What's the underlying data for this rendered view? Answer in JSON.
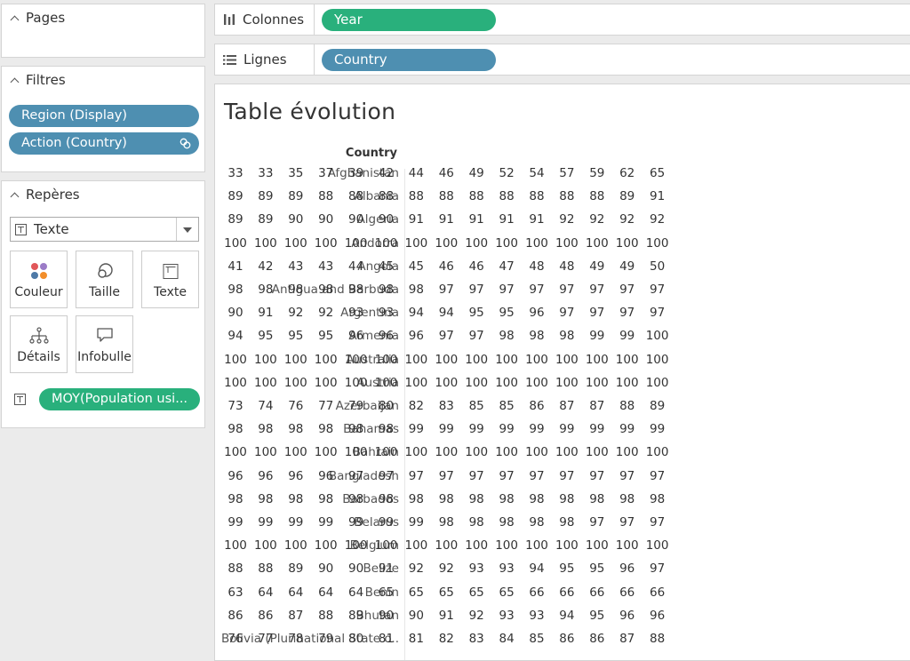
{
  "pages_panel": {
    "title": "Pages"
  },
  "filters_panel": {
    "title": "Filtres",
    "filters": [
      "Region (Display)",
      "Action (Country)"
    ]
  },
  "marks_panel": {
    "title": "Repères",
    "mark_type": "Texte",
    "buttons": [
      "Couleur",
      "Taille",
      "Texte",
      "Détails",
      "Infobulle"
    ],
    "text_field": "MOY(Population usi..."
  },
  "columns_shelf": {
    "label": "Colonnes",
    "pill": "Year"
  },
  "rows_shelf": {
    "label": "Lignes",
    "pill": "Country"
  },
  "view": {
    "title": "Table évolution",
    "row_header": "Country",
    "rows": [
      {
        "country": "Afghanistan",
        "values": [
          33,
          33,
          35,
          37,
          39,
          42,
          44,
          46,
          49,
          52,
          54,
          57,
          59,
          62,
          65
        ]
      },
      {
        "country": "Albania",
        "values": [
          89,
          89,
          89,
          88,
          88,
          88,
          88,
          88,
          88,
          88,
          88,
          88,
          88,
          89,
          91
        ]
      },
      {
        "country": "Algeria",
        "values": [
          89,
          89,
          90,
          90,
          90,
          90,
          91,
          91,
          91,
          91,
          91,
          92,
          92,
          92,
          92
        ]
      },
      {
        "country": "Andorra",
        "values": [
          100,
          100,
          100,
          100,
          100,
          100,
          100,
          100,
          100,
          100,
          100,
          100,
          100,
          100,
          100
        ]
      },
      {
        "country": "Angola",
        "values": [
          41,
          42,
          43,
          43,
          44,
          45,
          45,
          46,
          46,
          47,
          48,
          48,
          49,
          49,
          50
        ]
      },
      {
        "country": "Antigua and Barbuda",
        "values": [
          98,
          98,
          98,
          98,
          98,
          98,
          98,
          97,
          97,
          97,
          97,
          97,
          97,
          97,
          97
        ]
      },
      {
        "country": "Argentina",
        "values": [
          90,
          91,
          92,
          92,
          93,
          93,
          94,
          94,
          95,
          95,
          96,
          97,
          97,
          97,
          97
        ]
      },
      {
        "country": "Armenia",
        "values": [
          94,
          95,
          95,
          95,
          96,
          96,
          96,
          97,
          97,
          98,
          98,
          98,
          99,
          99,
          100
        ]
      },
      {
        "country": "Australia",
        "values": [
          100,
          100,
          100,
          100,
          100,
          100,
          100,
          100,
          100,
          100,
          100,
          100,
          100,
          100,
          100
        ]
      },
      {
        "country": "Austria",
        "values": [
          100,
          100,
          100,
          100,
          100,
          100,
          100,
          100,
          100,
          100,
          100,
          100,
          100,
          100,
          100
        ]
      },
      {
        "country": "Azerbaijan",
        "values": [
          73,
          74,
          76,
          77,
          79,
          80,
          82,
          83,
          85,
          85,
          86,
          87,
          87,
          88,
          89
        ]
      },
      {
        "country": "Bahamas",
        "values": [
          98,
          98,
          98,
          98,
          98,
          98,
          99,
          99,
          99,
          99,
          99,
          99,
          99,
          99,
          99
        ]
      },
      {
        "country": "Bahrain",
        "values": [
          100,
          100,
          100,
          100,
          100,
          100,
          100,
          100,
          100,
          100,
          100,
          100,
          100,
          100,
          100
        ]
      },
      {
        "country": "Bangladesh",
        "values": [
          96,
          96,
          96,
          96,
          97,
          97,
          97,
          97,
          97,
          97,
          97,
          97,
          97,
          97,
          97
        ]
      },
      {
        "country": "Barbados",
        "values": [
          98,
          98,
          98,
          98,
          98,
          98,
          98,
          98,
          98,
          98,
          98,
          98,
          98,
          98,
          98
        ]
      },
      {
        "country": "Belarus",
        "values": [
          99,
          99,
          99,
          99,
          99,
          99,
          99,
          98,
          98,
          98,
          98,
          98,
          97,
          97,
          97
        ]
      },
      {
        "country": "Belgium",
        "values": [
          100,
          100,
          100,
          100,
          100,
          100,
          100,
          100,
          100,
          100,
          100,
          100,
          100,
          100,
          100
        ]
      },
      {
        "country": "Belize",
        "values": [
          88,
          88,
          89,
          90,
          90,
          91,
          92,
          92,
          93,
          93,
          94,
          95,
          95,
          96,
          97
        ]
      },
      {
        "country": "Benin",
        "values": [
          63,
          64,
          64,
          64,
          64,
          65,
          65,
          65,
          65,
          65,
          66,
          66,
          66,
          66,
          66
        ]
      },
      {
        "country": "Bhutan",
        "values": [
          86,
          86,
          87,
          88,
          89,
          90,
          90,
          91,
          92,
          93,
          93,
          94,
          95,
          96,
          96
        ]
      },
      {
        "country": "Bolivia (Plurinational State o..",
        "values": [
          76,
          77,
          78,
          79,
          80,
          81,
          81,
          82,
          83,
          84,
          85,
          86,
          86,
          87,
          88
        ]
      }
    ]
  }
}
